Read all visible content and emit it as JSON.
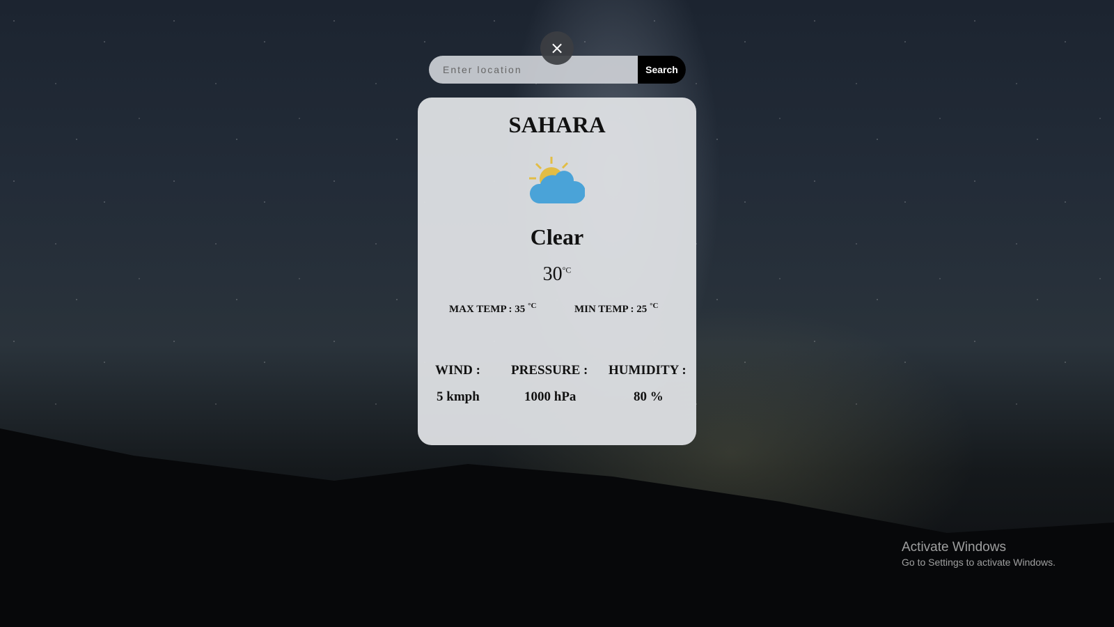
{
  "search": {
    "placeholder": "Enter location",
    "button_label": "Search"
  },
  "close_label": "×",
  "weather": {
    "city": "SAHARA",
    "icon": "partly-cloudy-icon",
    "condition": "Clear",
    "temp": "30",
    "unit": "°C",
    "max_temp": "MAX TEMP : 35",
    "min_temp": "MIN TEMP : 25",
    "wind_label": "WIND :",
    "wind_value": "5 kmph",
    "pressure_label": "PRESSURE :",
    "pressure_value": "1000 hPa",
    "humidity_label": "HUMIDITY :",
    "humidity_value": "80 %"
  },
  "colors": {
    "sun": "#e2bd45",
    "cloud": "#4aa3d8"
  },
  "watermark": {
    "title": "Activate Windows",
    "subtitle": "Go to Settings to activate Windows."
  }
}
